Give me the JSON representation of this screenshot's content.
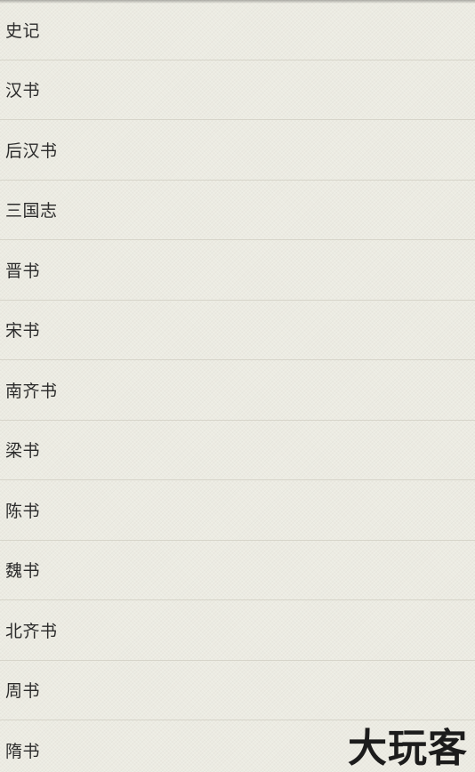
{
  "books": [
    {
      "label": "史记"
    },
    {
      "label": "汉书"
    },
    {
      "label": "后汉书"
    },
    {
      "label": "三国志"
    },
    {
      "label": "晋书"
    },
    {
      "label": "宋书"
    },
    {
      "label": "南齐书"
    },
    {
      "label": "梁书"
    },
    {
      "label": "陈书"
    },
    {
      "label": "魏书"
    },
    {
      "label": "北齐书"
    },
    {
      "label": "周书"
    },
    {
      "label": "隋书"
    }
  ],
  "watermark": {
    "text": "大玩客"
  }
}
